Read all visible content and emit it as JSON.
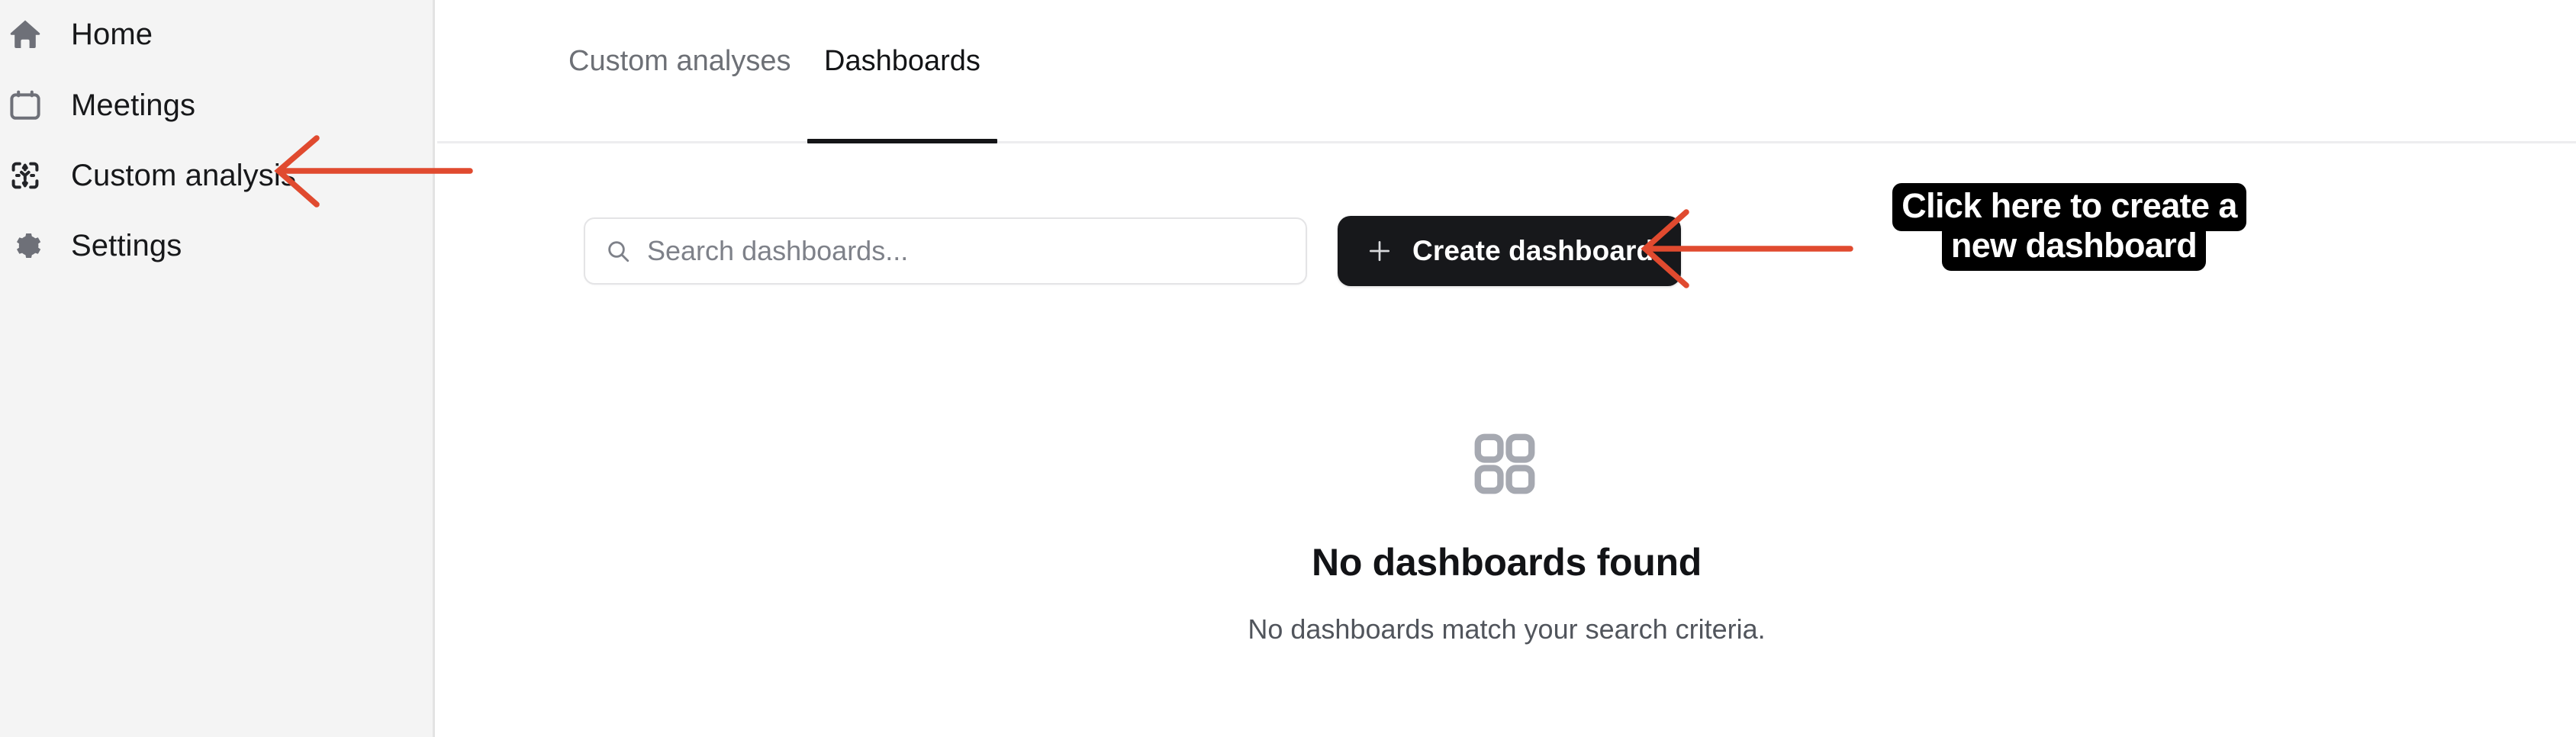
{
  "sidebar": {
    "background": "#f4f4f4",
    "items": [
      {
        "id": "home",
        "label": "Home",
        "icon": "home-icon"
      },
      {
        "id": "meetings",
        "label": "Meetings",
        "icon": "calendar-icon"
      },
      {
        "id": "custom-analysis",
        "label": "Custom analysis",
        "icon": "custom-analysis-icon"
      },
      {
        "id": "settings",
        "label": "Settings",
        "icon": "gear-icon"
      }
    ]
  },
  "tabs": [
    {
      "id": "custom-analyses",
      "label": "Custom analyses",
      "active": false
    },
    {
      "id": "dashboards",
      "label": "Dashboards",
      "active": true
    }
  ],
  "toolbar": {
    "search_placeholder": "Search dashboards...",
    "search_value": "",
    "search_icon": "search-icon",
    "create_label": "Create dashboard",
    "create_icon": "plus-icon",
    "create_bg": "#17181b"
  },
  "empty_state": {
    "icon": "grid-2x2-icon",
    "title": "No dashboards found",
    "subtitle": "No dashboards match your search criteria."
  },
  "annotations": {
    "accent": "#e04a2f",
    "callout_line1": "Click here to create a",
    "callout_line2": "new dashboard",
    "arrows": [
      {
        "id": "arrow-to-custom-analysis",
        "points_to": "custom-analysis"
      },
      {
        "id": "arrow-to-create-dashboard",
        "points_to": "create-dashboard"
      }
    ]
  }
}
